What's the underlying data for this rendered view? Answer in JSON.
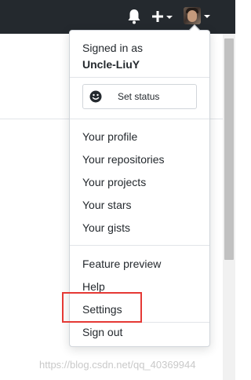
{
  "header": {
    "icons": [
      "bell-icon",
      "plus-icon",
      "avatar"
    ]
  },
  "dropdown": {
    "signed_in_label": "Signed in as",
    "username": "Uncle-LiuY",
    "status_button": {
      "icon": "smiley-icon",
      "label": "Set status"
    },
    "profile_items": [
      "Your profile",
      "Your repositories",
      "Your projects",
      "Your stars",
      "Your gists"
    ],
    "misc_items": [
      "Feature preview",
      "Help",
      "Settings",
      "Sign out"
    ]
  },
  "annotation": {
    "highlighted_item": "Settings",
    "color": "#e53935"
  },
  "watermark": "https://blog.csdn.net/qq_40369944"
}
